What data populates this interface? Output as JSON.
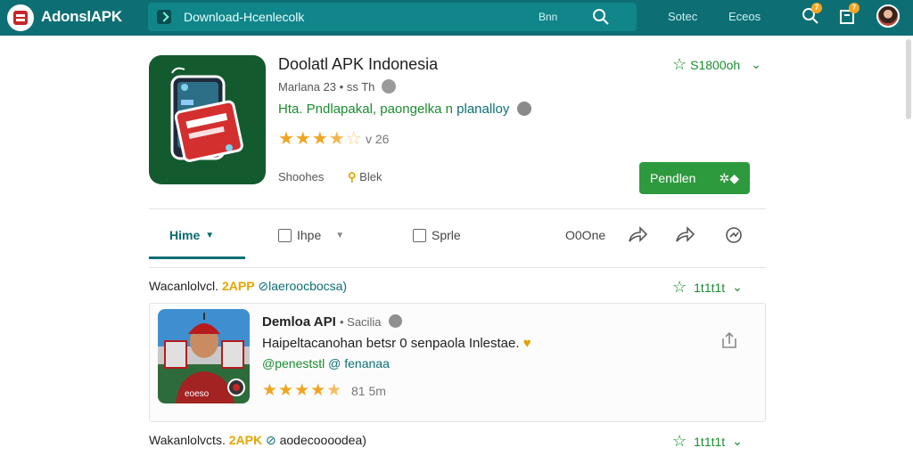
{
  "header": {
    "brand": "AdonslAPK",
    "search_placeholder": "Download-Hcenlecolk",
    "search_button": "Bnn",
    "nav": [
      "Sotec",
      "Eceos"
    ],
    "badges": [
      "7",
      "7"
    ]
  },
  "app": {
    "title": "Doolatl APK Indonesia",
    "meta": "Marlana 23 • ss Th",
    "desc_main": "Hta. Pndlapakal, paongelka n",
    "desc_tail": "planalloy",
    "rating_count": "26",
    "rating_stars": 3.5,
    "developer_label": "Shoohes",
    "developer_tag": "Blek",
    "fav_count": "S1800oh",
    "install_label": "Pendlen"
  },
  "tabs": [
    {
      "label": "Hime",
      "active": true
    },
    {
      "label": "Ihpe",
      "active": false
    },
    {
      "label": "Sprle",
      "active": false
    },
    {
      "label": "O0One",
      "active": false
    }
  ],
  "section1": {
    "label": "Wacanlolvcl.",
    "apk": "2APP",
    "link": "laeroocbocsa)",
    "right": "1t1t1t"
  },
  "result": {
    "title": "Demloa API",
    "subtitle": "Sacilia",
    "desc": "Haipeltacanohan betsr 0 senpaola Inlestae.",
    "handle": "@peneststl",
    "handle_link": "fenanaa",
    "rating_stars": 4.5,
    "rating_count": "81 5m",
    "thumb_caption": "eoeso"
  },
  "section2": {
    "label": "Wakanlolvcts.",
    "apk": "2APK",
    "link": "aodecoooodea)",
    "right": "1t1t1t"
  },
  "colors": {
    "topbar": "#0d6f74",
    "accent_green": "#2e9a3e",
    "star": "#f0a521",
    "link_teal": "#0b7076"
  }
}
